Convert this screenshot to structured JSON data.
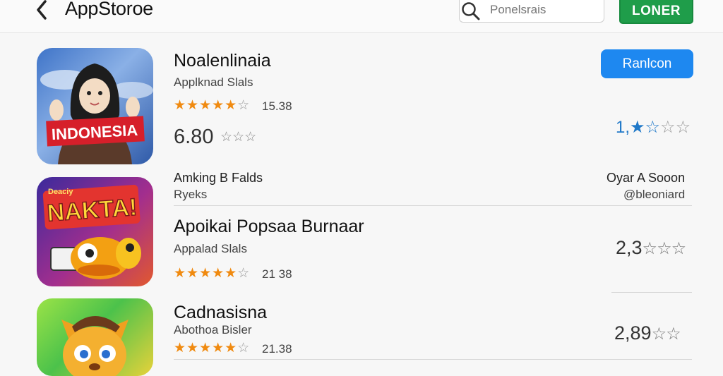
{
  "header": {
    "title": "AppStoroe",
    "search_placeholder": "Ponelsrais",
    "login_label": "LONER"
  },
  "section": {
    "left_label": "Amking B Falds",
    "left_sub": "Ryeks",
    "right_label": "Oyar A Sooon",
    "right_sub": "@bleoniard"
  },
  "apps": [
    {
      "title": "Noalenlinaia",
      "subtitle": "Applknad Slals",
      "stars_filled": 4,
      "rating_count": "15.38",
      "price": "6.80",
      "action_label": "Ranlcon",
      "right_rating": "1,",
      "icon_banner": "INDONESIA",
      "icon_name": "indonesia-app-icon"
    },
    {
      "title": "Apoikai Popsaa Burnaar",
      "subtitle": "Appalad Slals",
      "stars_filled": 4,
      "rating_count": "21 38",
      "right_rating": "2,3",
      "icon_banner": "NAKTA!",
      "icon_caption": "Deaciy",
      "icon_name": "nakta-app-icon"
    },
    {
      "title": "Cadnasisna",
      "subtitle": "Abothoa Bisler",
      "stars_filled": 4,
      "rating_count": "21.38",
      "right_rating": "2,89",
      "icon_name": "fox-app-icon"
    }
  ],
  "colors": {
    "login_green": "#1f9d4a",
    "action_blue": "#1e88f0",
    "star_orange": "#f08a10"
  }
}
